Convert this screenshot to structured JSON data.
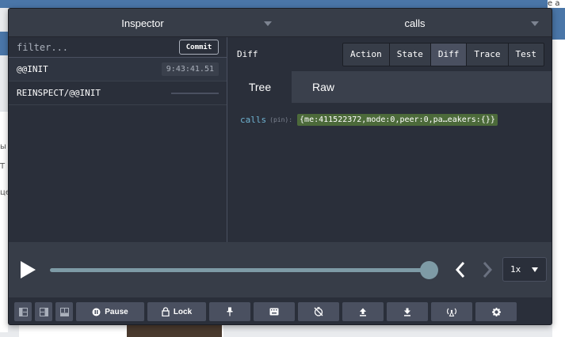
{
  "background": {
    "top_right_text": "e a",
    "left_fragments": [
      "ы",
      "Т",
      "це"
    ]
  },
  "monitors": {
    "left": "Inspector",
    "right": "calls"
  },
  "filter": {
    "placeholder": "filter...",
    "commit_label": "Commit"
  },
  "actions": [
    {
      "name": "@@INIT",
      "time": "9:43:41.51"
    },
    {
      "name": "REINSPECT/@@INIT",
      "time": ""
    }
  ],
  "inspector": {
    "title": "Diff",
    "tabs": [
      "Action",
      "State",
      "Diff",
      "Trace",
      "Test"
    ],
    "active_tab": "Diff",
    "subtabs": [
      "Tree",
      "Raw"
    ],
    "active_subtab": "Tree",
    "tree": {
      "key": "calls",
      "pin": "(pin):",
      "value": "{me:411522372,mode:0,peer:0,pa…eakers:{}}"
    }
  },
  "slider": {
    "position": 1.0,
    "speed": "1x"
  },
  "toolbar": {
    "pause_label": "Pause",
    "lock_label": "Lock",
    "icons": [
      "layout-left-icon",
      "layout-right-icon",
      "layout-bottom-icon",
      "pause-icon",
      "lock-icon",
      "pin-icon",
      "keyboard-icon",
      "timer-off-icon",
      "export-icon",
      "import-icon",
      "remote-icon",
      "settings-icon"
    ]
  },
  "colors": {
    "panel_bg": "#2a2f3a",
    "header_bg": "#373d48",
    "slider_color": "#7e9ba6",
    "tree_key": "#6fb3d2",
    "tree_value_bg": "#4c6a3a"
  }
}
